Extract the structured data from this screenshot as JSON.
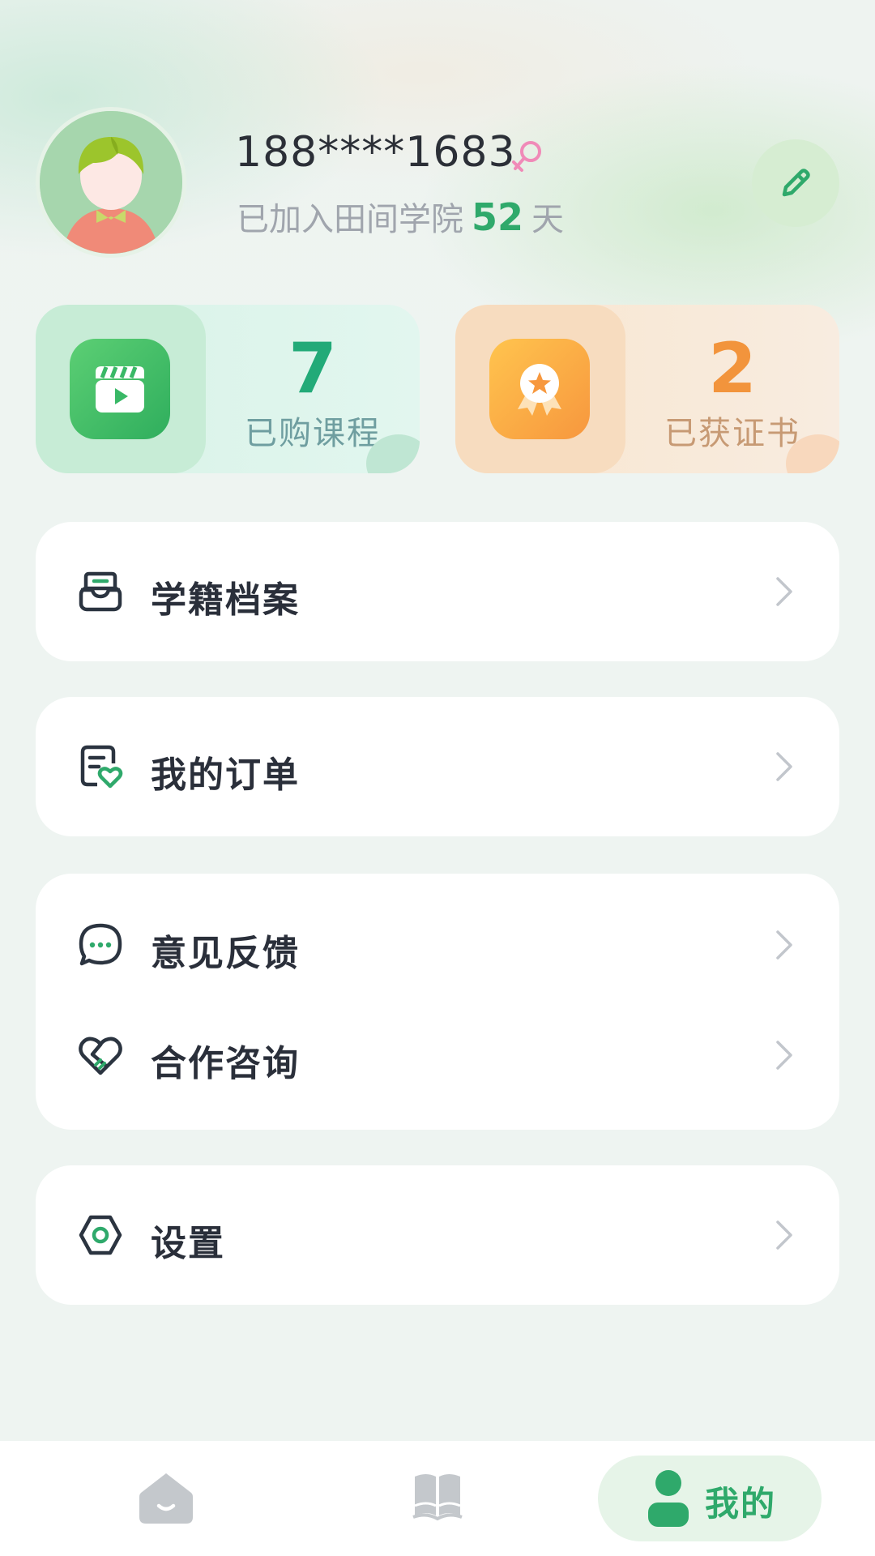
{
  "profile": {
    "phone": "188****1683",
    "gender_icon": "female-symbol-icon",
    "joined_prefix": "已加入田间学院",
    "joined_days": "52",
    "joined_suffix": "天",
    "edit_icon": "pencil-icon"
  },
  "stats": {
    "courses": {
      "value": "7",
      "label": "已购课程",
      "icon": "video-clapper-icon"
    },
    "certificates": {
      "value": "2",
      "label": "已获证书",
      "icon": "award-badge-icon"
    }
  },
  "menu": {
    "student_records": {
      "label": "学籍档案",
      "icon": "inbox-archive-icon"
    },
    "my_orders": {
      "label": "我的订单",
      "icon": "order-document-heart-icon"
    },
    "feedback": {
      "label": "意见反馈",
      "icon": "chat-bubble-icon"
    },
    "cooperation": {
      "label": "合作咨询",
      "icon": "heart-handshake-icon"
    },
    "settings": {
      "label": "设置",
      "icon": "hexagon-gear-icon"
    }
  },
  "bottom_nav": {
    "home_icon": "home-icon",
    "library_icon": "open-book-icon",
    "mine_label": "我的",
    "mine_icon": "person-icon",
    "active": "mine"
  },
  "colors": {
    "accent_green": "#2fa96b",
    "accent_orange": "#f2943c",
    "background": "#eef4f1"
  }
}
